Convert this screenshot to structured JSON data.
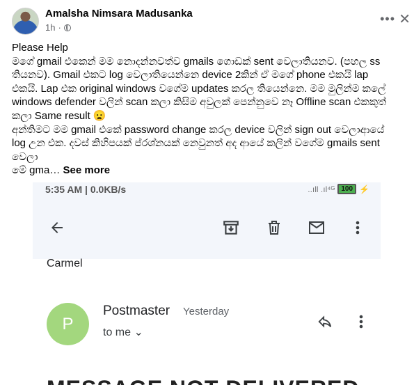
{
  "post": {
    "author": "Amalsha Nimsara Madusanka",
    "time": "1h",
    "more_icon": "more-dots-icon",
    "close_icon": "close-icon",
    "lines": [
      "Please Help",
      "මගේ gmail එකෙන් මම නොදන්නවත්ව gmails ගොඩක් sent වෙලාතියනව. (පහල ss",
      "තියනව). Gmail එකට log වෙලාතියෙන්නෙ device 2කින් ඒ මගේ phone එකයි lap",
      "එකයි. Lap එක original windows වගේම updates කරල තියෙන්නෙ. මම මුලින්ම කලේ",
      "windows defender වලින්  scan කලා කිසිම අවුලක් පෙන්නුවෙ නෑ Offline scan එකකුත්",
      "කලා Same result 😦",
      "අන්තිමට මම gmail එකේ password change කරල device වලින් sign out වෙලාආයේ",
      "log උන එක. දවස් කිහිපයක් ප්රශ්නයක් නෙවුනත්  අද ආයේ කලින් වගේම gmails sent",
      "වෙලා"
    ],
    "last_line_prefix": "මේ gma… ",
    "see_more": "See more"
  },
  "screenshot": {
    "status_time": "5:35 AM | 0.0KB/s",
    "status_signal": "..ıll .ıl⁴ᴳ",
    "battery": "100",
    "sender_top": "Carmel",
    "avatar_letter": "P",
    "sender_name": "Postmaster",
    "sent_time": "Yesterday",
    "to_me": "to me",
    "headline": "MESSAGE NOT DELIVERED"
  }
}
